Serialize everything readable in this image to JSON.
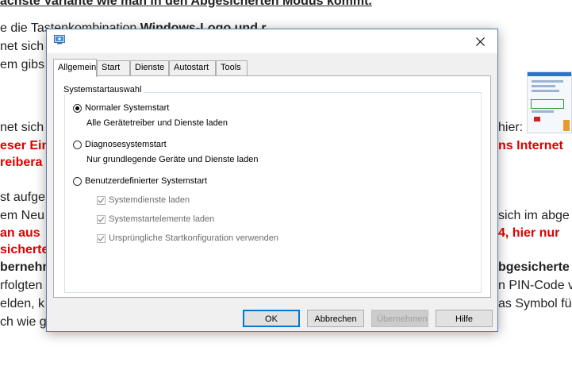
{
  "background": {
    "lines": [
      {
        "text": "ächste Variante wie man in den Abgesicherten Modus kommt.",
        "style": "heading"
      },
      {
        "pre": "e die Tastenkombination ",
        "bold": "Windows-Logo und r"
      },
      {
        "text": "net sich d"
      },
      {
        "text": "em gibs"
      },
      {
        "text": "net sich d",
        "right": "hier:"
      },
      {
        "red": "eser Ein",
        "red_right": "ns Internet"
      },
      {
        "red": "reibera"
      },
      {
        "text": "st aufge"
      },
      {
        "text": "em Neu",
        "right": "sich im abge"
      },
      {
        "red": "an aus",
        "red_right": "4, hier nur"
      },
      {
        "red": "sicherte"
      },
      {
        "bold": "bernehm",
        "bold_right": "bgesicherte"
      },
      {
        "text": "rfolgten",
        "right": "n PIN-Code v"
      },
      {
        "text": "elden, k",
        "right": "as Symbol fü"
      },
      {
        "text": "ch wie g"
      }
    ]
  },
  "dialog": {
    "close_label": "close",
    "tabs": [
      {
        "label": "Allgemein",
        "active": true
      },
      {
        "label": "Start",
        "active": false
      },
      {
        "label": "Dienste",
        "active": false
      },
      {
        "label": "Autostart",
        "active": false
      },
      {
        "label": "Tools",
        "active": false
      }
    ],
    "group_label": "Systemstartauswahl",
    "options": [
      {
        "label": "Normaler Systemstart",
        "description": "Alle Gerätetreiber und Dienste laden",
        "checked": true
      },
      {
        "label": "Diagnosesystemstart",
        "description": "Nur grundlegende Geräte und Dienste laden",
        "checked": false
      },
      {
        "label": "Benutzerdefinierter Systemstart",
        "checked": false
      }
    ],
    "checkboxes": [
      {
        "label": "Systemdienste laden",
        "checked": true,
        "enabled": false
      },
      {
        "label": "Systemstartelemente laden",
        "checked": true,
        "enabled": false
      },
      {
        "label": "Ursprüngliche Startkonfiguration verwenden",
        "checked": true,
        "enabled": false
      }
    ],
    "buttons": {
      "ok": "OK",
      "cancel": "Abbrechen",
      "apply": "Übernehmen",
      "help": "Hilfe"
    }
  }
}
